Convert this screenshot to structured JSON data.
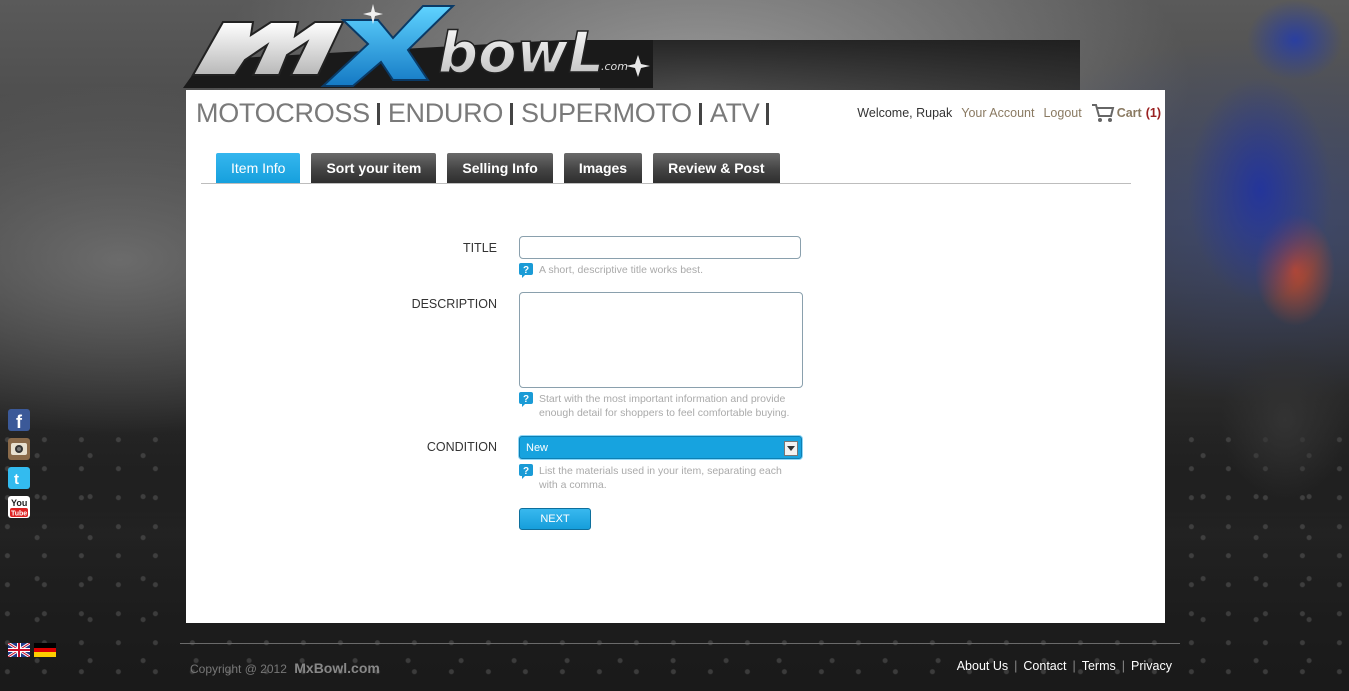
{
  "brand": {
    "logo_text": "mXbowl.com"
  },
  "categories": [
    "MOTOCROSS",
    "ENDURO",
    "SUPERMOTO",
    "ATV"
  ],
  "account": {
    "welcome": "Welcome, Rupak",
    "your_account": "Your Account",
    "logout": "Logout",
    "cart_label": "Cart",
    "cart_count": "(1)"
  },
  "tabs": [
    {
      "label": "Item Info",
      "active": true
    },
    {
      "label": "Sort your item",
      "active": false
    },
    {
      "label": "Selling Info",
      "active": false
    },
    {
      "label": "Images",
      "active": false
    },
    {
      "label": "Review & Post",
      "active": false
    }
  ],
  "form": {
    "title_label": "TITLE",
    "title_value": "",
    "title_hint": "A short, descriptive title works best.",
    "description_label": "DESCRIPTION",
    "description_value": "",
    "description_hint": "Start with the most important information and provide enough detail for shoppers to feel comfortable buying.",
    "condition_label": "CONDITION",
    "condition_value": "New",
    "condition_hint": "List the materials used in your item, separating each with a comma.",
    "next_label": "NEXT"
  },
  "social": [
    "facebook-icon",
    "instagram-icon",
    "twitter-icon",
    "youtube-icon"
  ],
  "languages": [
    "english-flag-icon",
    "german-flag-icon"
  ],
  "footer": {
    "copyright": "Copyright @ 2012",
    "brand": "MxBowl.com",
    "links": [
      "About Us",
      "Contact",
      "Terms",
      "Privacy"
    ]
  },
  "colors": {
    "accent": "#16a0dd",
    "tab_dark": "#444444",
    "cart_count": "#9a2020"
  }
}
